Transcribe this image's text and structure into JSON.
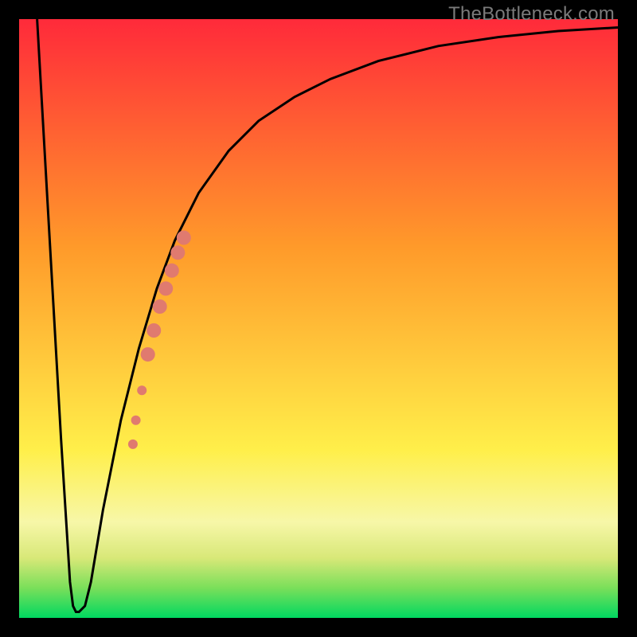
{
  "watermark": "TheBottleneck.com",
  "colors": {
    "red_top": "#ff2a3a",
    "orange": "#ff9a2a",
    "yellow": "#ffef4a",
    "pale_yellow": "#f7f7a8",
    "green_light": "#7adf5a",
    "green": "#00d860",
    "curve_stroke": "#000000",
    "dot_fill": "#e07a6f",
    "frame": "#000000"
  },
  "chart_data": {
    "type": "line",
    "title": "",
    "xlabel": "",
    "ylabel": "",
    "xlim": [
      0,
      100
    ],
    "ylim": [
      0,
      100
    ],
    "series": [
      {
        "name": "bottleneck-curve",
        "x": [
          3,
          7,
          8.5,
          9,
          9.5,
          10,
          11,
          12,
          14,
          17,
          20,
          23,
          26,
          30,
          35,
          40,
          46,
          52,
          60,
          70,
          80,
          90,
          100
        ],
        "y": [
          100,
          30,
          6,
          2,
          1,
          1,
          2,
          6,
          18,
          33,
          45,
          55,
          63,
          71,
          78,
          83,
          87,
          90,
          93,
          95.5,
          97,
          98,
          98.6
        ]
      }
    ],
    "flat_segment": {
      "x_start": 9,
      "x_end": 10,
      "y": 1
    },
    "highlight_dots": {
      "name": "highlight-segment",
      "points": [
        {
          "x": 19.0,
          "y": 29,
          "r": 6
        },
        {
          "x": 19.5,
          "y": 33,
          "r": 6
        },
        {
          "x": 20.5,
          "y": 38,
          "r": 6
        },
        {
          "x": 21.5,
          "y": 44,
          "r": 9
        },
        {
          "x": 22.5,
          "y": 48,
          "r": 9
        },
        {
          "x": 23.5,
          "y": 52,
          "r": 9
        },
        {
          "x": 24.5,
          "y": 55,
          "r": 9
        },
        {
          "x": 25.5,
          "y": 58,
          "r": 9
        },
        {
          "x": 26.5,
          "y": 61,
          "r": 9
        },
        {
          "x": 27.5,
          "y": 63.5,
          "r": 9
        }
      ]
    },
    "gradient_stops": [
      {
        "offset": 0.0,
        "color": "#ff2a3a"
      },
      {
        "offset": 0.38,
        "color": "#ff9a2a"
      },
      {
        "offset": 0.72,
        "color": "#ffef4a"
      },
      {
        "offset": 0.84,
        "color": "#f7f7a8"
      },
      {
        "offset": 0.9,
        "color": "#d8e878"
      },
      {
        "offset": 0.95,
        "color": "#7adf5a"
      },
      {
        "offset": 1.0,
        "color": "#00d860"
      }
    ]
  }
}
